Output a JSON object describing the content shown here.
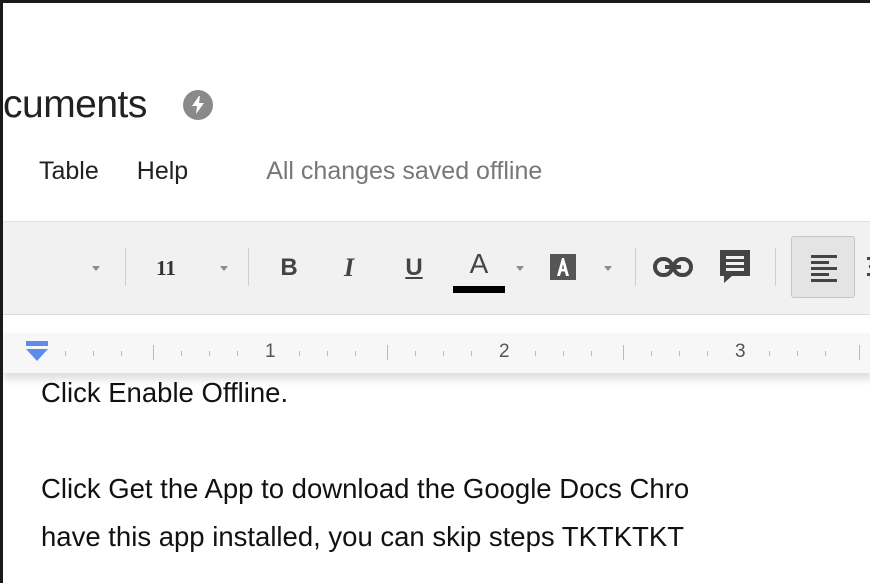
{
  "document": {
    "title_fragment": "cuments"
  },
  "menu": {
    "items": [
      "Table",
      "Help"
    ],
    "save_status": "All changes saved offline"
  },
  "toolbar": {
    "font_size": "11",
    "bold_glyph": "B",
    "italic_glyph": "I",
    "underline_glyph": "U",
    "text_color_glyph": "A",
    "highlight_glyph": "A",
    "text_color": "#000000"
  },
  "ruler": {
    "numbers": [
      "1",
      "2",
      "3"
    ]
  },
  "content": {
    "paragraph1": "Click Enable Offline.",
    "paragraph2_line1": "Click Get the App to download the Google Docs Chro",
    "paragraph2_line2": "have this app installed, you can skip steps TKTKTKT"
  },
  "colors": {
    "toolbar_bg": "#f1f1f1",
    "ruler_marker": "#5b8def",
    "status_text": "#777777"
  }
}
